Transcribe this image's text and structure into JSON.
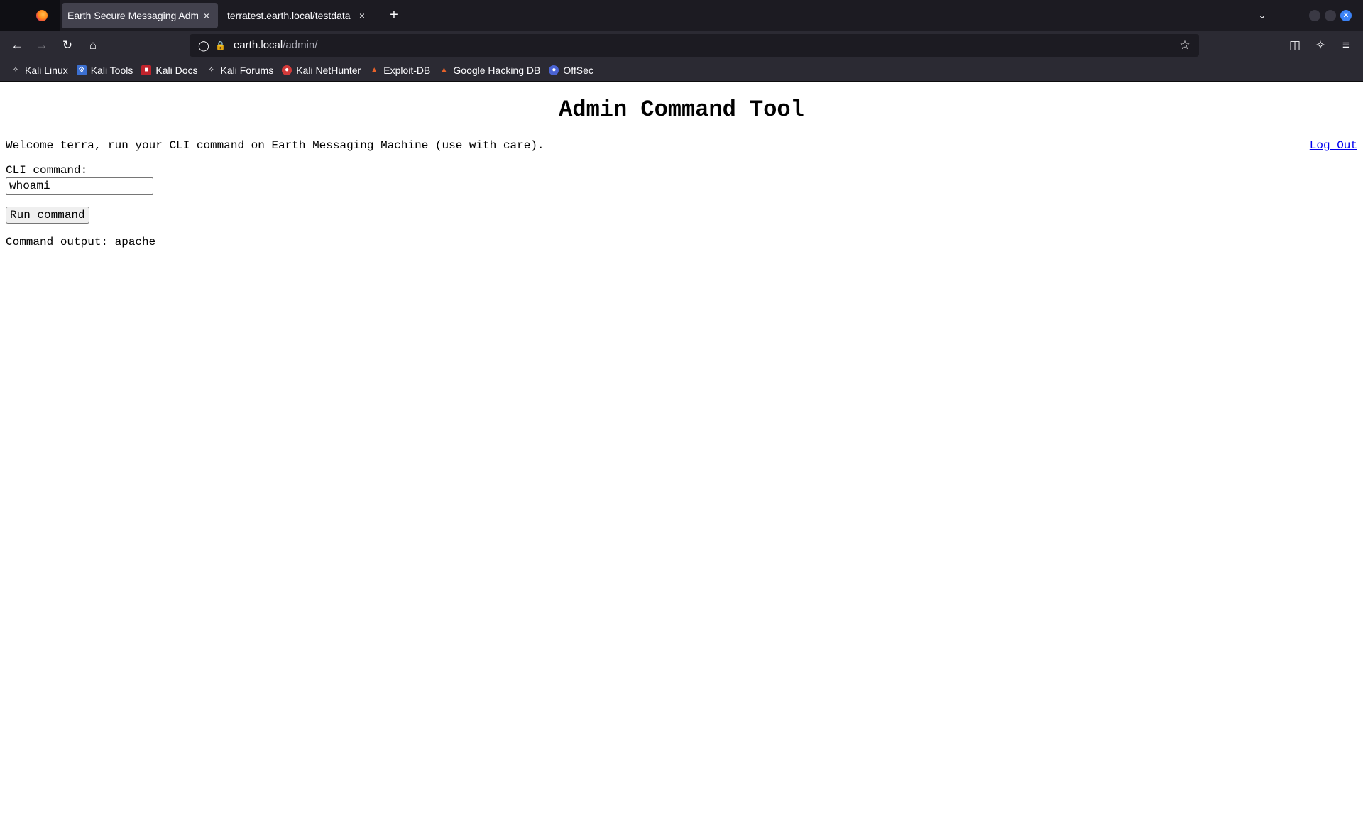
{
  "browser": {
    "tabs": [
      {
        "title": "Earth Secure Messaging Adm",
        "active": true
      },
      {
        "title": "terratest.earth.local/testdata",
        "active": false
      }
    ],
    "new_tab": "+",
    "close_glyph": "×",
    "url_host": "earth.local",
    "url_path": "/admin/",
    "bookmarks": [
      {
        "label": "Kali Linux",
        "icon": "kali-dragon-icon",
        "color": "#2b2a33"
      },
      {
        "label": "Kali Tools",
        "icon": "kali-tools-icon",
        "color": "#3b6fd1"
      },
      {
        "label": "Kali Docs",
        "icon": "kali-docs-icon",
        "color": "#c0232c"
      },
      {
        "label": "Kali Forums",
        "icon": "kali-forums-icon",
        "color": "#2b2a33"
      },
      {
        "label": "Kali NetHunter",
        "icon": "nethunter-icon",
        "color": "#d33a3a"
      },
      {
        "label": "Exploit-DB",
        "icon": "exploit-db-icon",
        "color": "#e8622a"
      },
      {
        "label": "Google Hacking DB",
        "icon": "ghdb-icon",
        "color": "#e8622a"
      },
      {
        "label": "OffSec",
        "icon": "offsec-icon",
        "color": "#4a63d3"
      }
    ]
  },
  "page": {
    "title": "Admin Command Tool",
    "welcome": "Welcome terra, run your CLI command on Earth Messaging Machine (use with care).",
    "logout": "Log Out",
    "cli_label": "CLI command:",
    "cli_value": "whoami",
    "run_button": "Run command",
    "output": "Command output: apache"
  }
}
